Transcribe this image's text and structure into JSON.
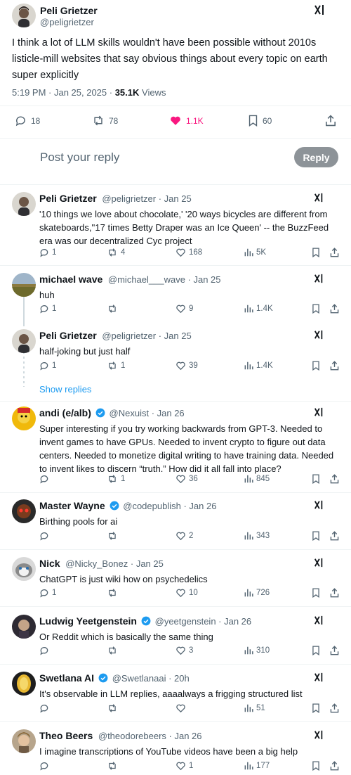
{
  "main_post": {
    "author_name": "Peli Grietzer",
    "author_handle": "@peligrietzer",
    "text": "I think a lot of LLM skills wouldn't have been possible without 2010s listicle-mill websites that say obvious things about every topic on earth super explicitly",
    "time": "5:19 PM · Jan 25, 2025 · ",
    "views_count": "35.1K",
    "views_label": " Views",
    "replies": "18",
    "reposts": "78",
    "likes": "1.1K",
    "bookmarks": "60"
  },
  "reply_box": {
    "placeholder": "Post your reply",
    "button": "Reply"
  },
  "show_replies": "Show replies",
  "replies": [
    {
      "name": "Peli Grietzer",
      "handle": "@peligrietzer · Jan 25",
      "text": "'10 things we love about chocolate,' '20 ways bicycles are different from skateboards,''17 times Betty Draper was an Ice Queen' -- the BuzzFeed era was our decentralized Cyc project",
      "replies": "1",
      "reposts": "4",
      "likes": "168",
      "views": "5K",
      "verified": false
    },
    {
      "name": "michael wave",
      "handle": "@michael___wave · Jan 25",
      "text": "huh",
      "replies": "1",
      "reposts": "",
      "likes": "9",
      "views": "1.4K",
      "verified": false
    },
    {
      "name": "Peli Grietzer",
      "handle": "@peligrietzer · Jan 25",
      "text": "half-joking but just half",
      "replies": "1",
      "reposts": "1",
      "likes": "39",
      "views": "1.4K",
      "verified": false
    },
    {
      "name": "andi (e/alb)",
      "handle": "@Nexuist · Jan 26",
      "text": "Super interesting if you try working backwards from GPT-3. Needed to invent games to have GPUs. Needed to invent crypto to figure out data centers. Needed to monetize digital writing to have training data. Needed to invent likes to discern “truth.” How did it all fall into place?",
      "replies": "",
      "reposts": "1",
      "likes": "36",
      "views": "845",
      "verified": true
    },
    {
      "name": "Master Wayne",
      "handle": "@codepublish · Jan 26",
      "text": "Birthing pools for ai",
      "replies": "",
      "reposts": "",
      "likes": "2",
      "views": "343",
      "verified": true
    },
    {
      "name": "Nick",
      "handle": "@Nicky_Bonez · Jan 25",
      "text": "ChatGPT is just wiki how on psychedelics",
      "replies": "1",
      "reposts": "",
      "likes": "10",
      "views": "726",
      "verified": false
    },
    {
      "name": "Ludwig Yeetgenstein",
      "handle": "@yeetgenstein · Jan 26",
      "text": "Or Reddit which is basically the same thing",
      "replies": "",
      "reposts": "",
      "likes": "3",
      "views": "310",
      "verified": true
    },
    {
      "name": "Swetlana AI",
      "handle": "@Swetlanaai · 20h",
      "text": "It's observable in LLM replies, aaaalways a frigging structured list",
      "replies": "",
      "reposts": "",
      "likes": "",
      "views": "51",
      "verified": true
    },
    {
      "name": "Theo Beers",
      "handle": "@theodorebeers · Jan 26",
      "text": "I imagine transcriptions of YouTube videos have been a big help",
      "replies": "",
      "reposts": "",
      "likes": "1",
      "views": "177",
      "verified": false
    }
  ]
}
